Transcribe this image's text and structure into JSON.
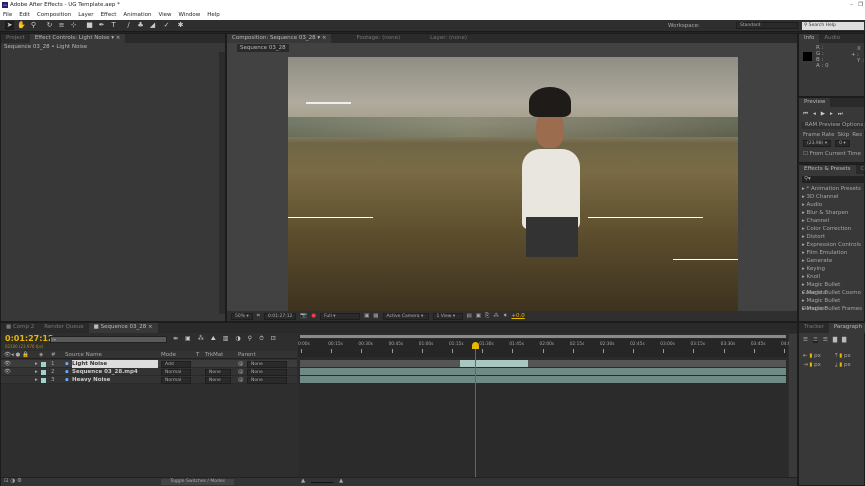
{
  "app": {
    "title": "Adobe After Effects - UG Template.aep *",
    "logo": "Ae"
  },
  "menu": [
    "File",
    "Edit",
    "Composition",
    "Layer",
    "Effect",
    "Animation",
    "View",
    "Window",
    "Help"
  ],
  "toolbar": {
    "workspace_label": "Workspace:",
    "workspace_value": "Standard",
    "search_placeholder": "Search Help"
  },
  "left_panel": {
    "tabs": [
      "Project",
      "Effect Controls: Light Noise"
    ],
    "breadcrumb": "Sequence 03_28 • Light Noise"
  },
  "comp_panel": {
    "tabs": [
      "Composition: Sequence 03_28",
      "Footage: (none)",
      "Layer: (none)"
    ],
    "subtab": "Sequence 03_28",
    "bottom": {
      "zoom": "50%",
      "timecode": "0:01:27:12",
      "resolution": "Full",
      "camera": "Active Camera",
      "view": "1 View",
      "exposure": "+0.0"
    }
  },
  "info_panel": {
    "tabs": [
      "Info",
      "Audio"
    ],
    "channels": [
      "R :",
      "G :",
      "B :",
      "A : 0"
    ],
    "coords": [
      "X :",
      "Y :"
    ]
  },
  "preview_panel": {
    "tab": "Preview",
    "ram_options": "RAM Preview Options",
    "frame_rate_label": "Frame Rate",
    "skip_label": "Skip",
    "res_label": "Res",
    "frame_rate": "(23.98)",
    "skip": "0",
    "from_current": "From Current Time"
  },
  "effects_panel": {
    "tabs": [
      "Effects & Presets",
      "Character"
    ],
    "items": [
      "* Animation Presets",
      "3D Channel",
      "Audio",
      "Blur & Sharpen",
      "Channel",
      "Color Correction",
      "Distort",
      "Expression Controls",
      "Film Emulation",
      "Generate",
      "Keying",
      "Knoll",
      "Magic Bullet Colorista",
      "Magic Bullet Cosmo",
      "Magic Bullet Denoiser",
      "Magic Bullet Frames"
    ]
  },
  "timeline": {
    "tabs": [
      "Comp 2",
      "Render Queue",
      "Sequence 03_28"
    ],
    "timecode": "0:01:27:12",
    "frame_info": "02100 (23.976 fps)",
    "headers": {
      "num": "#",
      "source": "Source Name",
      "mode": "Mode",
      "t": "T",
      "trkmat": "TrkMat",
      "parent": "Parent"
    },
    "layers": [
      {
        "num": "1",
        "name": "Light Noise",
        "mode": "Add",
        "trkmat": "",
        "parent": "None",
        "start": 0.33,
        "end": 0.47
      },
      {
        "num": "2",
        "name": "Sequence 03_28.mp4",
        "mode": "Normal",
        "trkmat": "None",
        "parent": "None",
        "start": 0.0,
        "end": 1.0
      },
      {
        "num": "3",
        "name": "Heavy Noise",
        "mode": "Normal",
        "trkmat": "None",
        "parent": "None",
        "start": 0.0,
        "end": 1.0
      }
    ],
    "ruler": [
      "0:00s",
      "00:15s",
      "00:30s",
      "00:45s",
      "01:00s",
      "01:15s",
      "01:30s",
      "01:45s",
      "02:00s",
      "02:15s",
      "02:30s",
      "02:45s",
      "03:00s",
      "03:15s",
      "03:30s",
      "03:45s",
      "04:0"
    ],
    "playhead_fraction": 0.36,
    "toggle_label": "Toggle Switches / Modes"
  },
  "paragraph_panel": {
    "tabs": [
      "Tracker",
      "Paragraph"
    ],
    "units": [
      "px",
      "px",
      "px",
      "px"
    ]
  }
}
